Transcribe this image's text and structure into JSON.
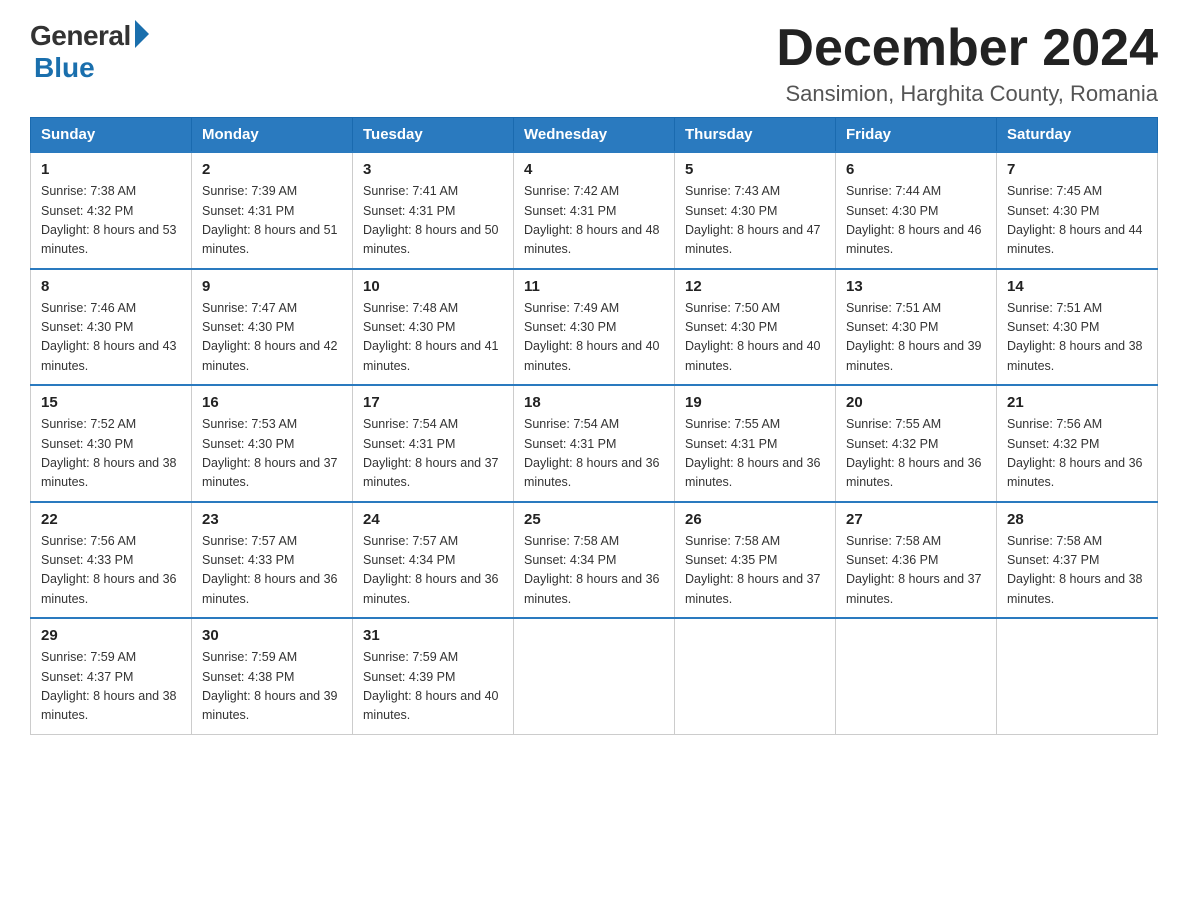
{
  "header": {
    "logo_general": "General",
    "logo_blue": "Blue",
    "main_title": "December 2024",
    "subtitle": "Sansimion, Harghita County, Romania"
  },
  "calendar": {
    "days_of_week": [
      "Sunday",
      "Monday",
      "Tuesday",
      "Wednesday",
      "Thursday",
      "Friday",
      "Saturday"
    ],
    "weeks": [
      [
        {
          "day": "1",
          "sunrise": "7:38 AM",
          "sunset": "4:32 PM",
          "daylight": "8 hours and 53 minutes."
        },
        {
          "day": "2",
          "sunrise": "7:39 AM",
          "sunset": "4:31 PM",
          "daylight": "8 hours and 51 minutes."
        },
        {
          "day": "3",
          "sunrise": "7:41 AM",
          "sunset": "4:31 PM",
          "daylight": "8 hours and 50 minutes."
        },
        {
          "day": "4",
          "sunrise": "7:42 AM",
          "sunset": "4:31 PM",
          "daylight": "8 hours and 48 minutes."
        },
        {
          "day": "5",
          "sunrise": "7:43 AM",
          "sunset": "4:30 PM",
          "daylight": "8 hours and 47 minutes."
        },
        {
          "day": "6",
          "sunrise": "7:44 AM",
          "sunset": "4:30 PM",
          "daylight": "8 hours and 46 minutes."
        },
        {
          "day": "7",
          "sunrise": "7:45 AM",
          "sunset": "4:30 PM",
          "daylight": "8 hours and 44 minutes."
        }
      ],
      [
        {
          "day": "8",
          "sunrise": "7:46 AM",
          "sunset": "4:30 PM",
          "daylight": "8 hours and 43 minutes."
        },
        {
          "day": "9",
          "sunrise": "7:47 AM",
          "sunset": "4:30 PM",
          "daylight": "8 hours and 42 minutes."
        },
        {
          "day": "10",
          "sunrise": "7:48 AM",
          "sunset": "4:30 PM",
          "daylight": "8 hours and 41 minutes."
        },
        {
          "day": "11",
          "sunrise": "7:49 AM",
          "sunset": "4:30 PM",
          "daylight": "8 hours and 40 minutes."
        },
        {
          "day": "12",
          "sunrise": "7:50 AM",
          "sunset": "4:30 PM",
          "daylight": "8 hours and 40 minutes."
        },
        {
          "day": "13",
          "sunrise": "7:51 AM",
          "sunset": "4:30 PM",
          "daylight": "8 hours and 39 minutes."
        },
        {
          "day": "14",
          "sunrise": "7:51 AM",
          "sunset": "4:30 PM",
          "daylight": "8 hours and 38 minutes."
        }
      ],
      [
        {
          "day": "15",
          "sunrise": "7:52 AM",
          "sunset": "4:30 PM",
          "daylight": "8 hours and 38 minutes."
        },
        {
          "day": "16",
          "sunrise": "7:53 AM",
          "sunset": "4:30 PM",
          "daylight": "8 hours and 37 minutes."
        },
        {
          "day": "17",
          "sunrise": "7:54 AM",
          "sunset": "4:31 PM",
          "daylight": "8 hours and 37 minutes."
        },
        {
          "day": "18",
          "sunrise": "7:54 AM",
          "sunset": "4:31 PM",
          "daylight": "8 hours and 36 minutes."
        },
        {
          "day": "19",
          "sunrise": "7:55 AM",
          "sunset": "4:31 PM",
          "daylight": "8 hours and 36 minutes."
        },
        {
          "day": "20",
          "sunrise": "7:55 AM",
          "sunset": "4:32 PM",
          "daylight": "8 hours and 36 minutes."
        },
        {
          "day": "21",
          "sunrise": "7:56 AM",
          "sunset": "4:32 PM",
          "daylight": "8 hours and 36 minutes."
        }
      ],
      [
        {
          "day": "22",
          "sunrise": "7:56 AM",
          "sunset": "4:33 PM",
          "daylight": "8 hours and 36 minutes."
        },
        {
          "day": "23",
          "sunrise": "7:57 AM",
          "sunset": "4:33 PM",
          "daylight": "8 hours and 36 minutes."
        },
        {
          "day": "24",
          "sunrise": "7:57 AM",
          "sunset": "4:34 PM",
          "daylight": "8 hours and 36 minutes."
        },
        {
          "day": "25",
          "sunrise": "7:58 AM",
          "sunset": "4:34 PM",
          "daylight": "8 hours and 36 minutes."
        },
        {
          "day": "26",
          "sunrise": "7:58 AM",
          "sunset": "4:35 PM",
          "daylight": "8 hours and 37 minutes."
        },
        {
          "day": "27",
          "sunrise": "7:58 AM",
          "sunset": "4:36 PM",
          "daylight": "8 hours and 37 minutes."
        },
        {
          "day": "28",
          "sunrise": "7:58 AM",
          "sunset": "4:37 PM",
          "daylight": "8 hours and 38 minutes."
        }
      ],
      [
        {
          "day": "29",
          "sunrise": "7:59 AM",
          "sunset": "4:37 PM",
          "daylight": "8 hours and 38 minutes."
        },
        {
          "day": "30",
          "sunrise": "7:59 AM",
          "sunset": "4:38 PM",
          "daylight": "8 hours and 39 minutes."
        },
        {
          "day": "31",
          "sunrise": "7:59 AM",
          "sunset": "4:39 PM",
          "daylight": "8 hours and 40 minutes."
        },
        null,
        null,
        null,
        null
      ]
    ]
  }
}
